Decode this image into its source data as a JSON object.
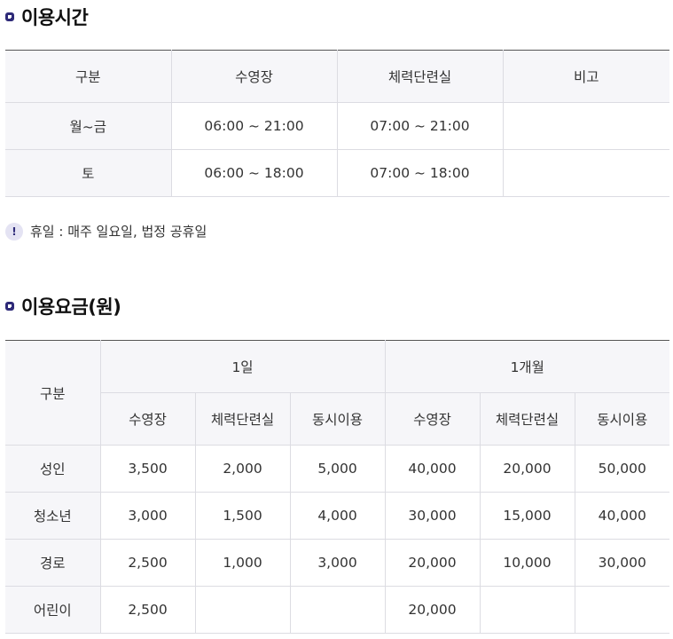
{
  "hours": {
    "title": "이용시간",
    "headers": [
      "구분",
      "수영장",
      "체력단련실",
      "비고"
    ],
    "rows": [
      {
        "label": "월~금",
        "pool": "06:00 ~ 21:00",
        "gym": "07:00 ~ 21:00",
        "note": ""
      },
      {
        "label": "토",
        "pool": "06:00 ~ 18:00",
        "gym": "07:00 ~ 18:00",
        "note": ""
      }
    ],
    "notice_icon": "exclamation-icon",
    "notice": "휴일 : 매주 일요일, 법정 공휴일"
  },
  "fees": {
    "title": "이용요금(원)",
    "category_header": "구분",
    "period_headers": [
      "1일",
      "1개월"
    ],
    "sub_headers": [
      "수영장",
      "체력단련실",
      "동시이용",
      "수영장",
      "체력단련실",
      "동시이용"
    ],
    "rows": [
      {
        "label": "성인",
        "values": [
          "3,500",
          "2,000",
          "5,000",
          "40,000",
          "20,000",
          "50,000"
        ]
      },
      {
        "label": "청소년",
        "values": [
          "3,000",
          "1,500",
          "4,000",
          "30,000",
          "15,000",
          "40,000"
        ]
      },
      {
        "label": "경로",
        "values": [
          "2,500",
          "1,000",
          "3,000",
          "20,000",
          "10,000",
          "30,000"
        ]
      },
      {
        "label": "어린이",
        "values": [
          "2,500",
          "",
          "",
          "20,000",
          "",
          ""
        ]
      }
    ]
  },
  "colors": {
    "accent": "#2e2a78",
    "header_bg": "#f6f6f9",
    "border": "#dcdce2"
  }
}
